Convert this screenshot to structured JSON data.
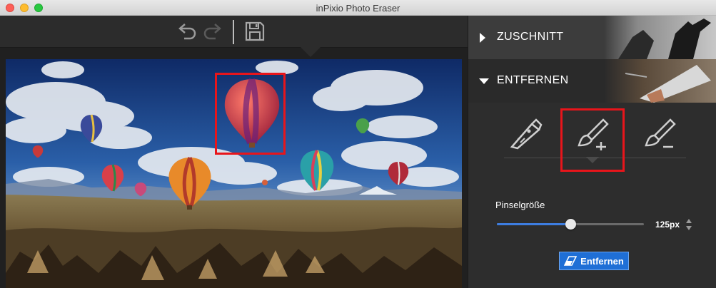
{
  "window": {
    "title": "inPixio Photo Eraser"
  },
  "toolbar": {
    "undo_icon": "undo-icon",
    "redo_icon": "redo-icon",
    "save_icon": "save-icon"
  },
  "panel": {
    "sections": [
      {
        "label": "ZUSCHNITT",
        "expanded": false
      },
      {
        "label": "ENTFERNEN",
        "expanded": true
      }
    ],
    "tools": [
      {
        "icon": "cutter-icon",
        "selected": false
      },
      {
        "icon": "brush-add-icon",
        "selected": true
      },
      {
        "icon": "brush-remove-icon",
        "selected": false
      }
    ],
    "brush_size_label": "Pinselgröße",
    "brush_size_value": "125px",
    "brush_size_fraction": 0.5,
    "remove_button": "Entfernen",
    "accent": "#1f6fd6",
    "highlight": "#e8151b"
  }
}
